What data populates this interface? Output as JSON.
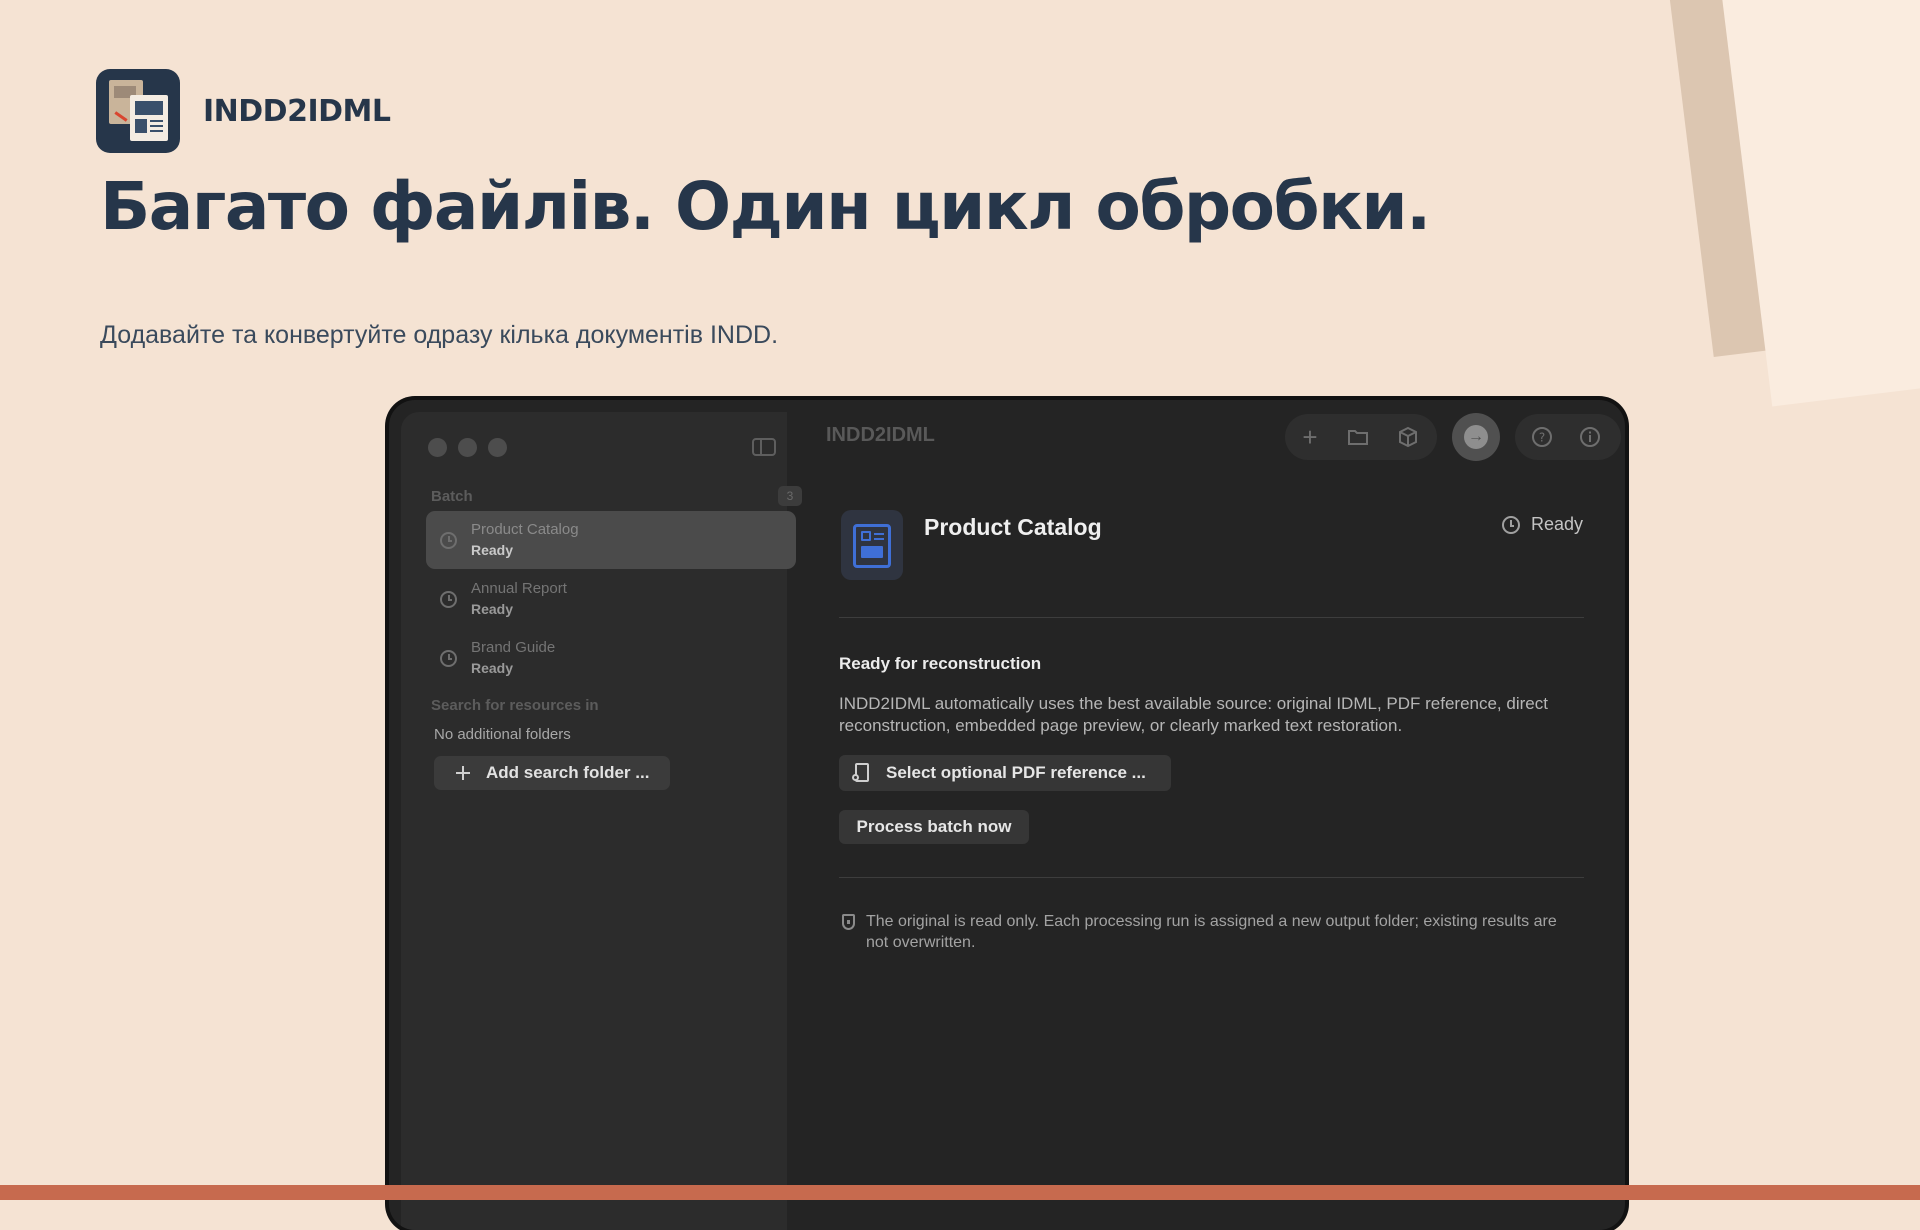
{
  "brand": {
    "name": "INDD2IDML"
  },
  "hero": {
    "headline": "Багато файлів. Один цикл обробки.",
    "subline": "Додавайте та конвертуйте одразу кілька документів INDD."
  },
  "app": {
    "window_title": "INDD2IDML",
    "sidebar": {
      "batch_label": "Batch",
      "batch_count": "3",
      "items": [
        {
          "name": "Product Catalog",
          "status": "Ready",
          "selected": true
        },
        {
          "name": "Annual Report",
          "status": "Ready",
          "selected": false
        },
        {
          "name": "Brand Guide",
          "status": "Ready",
          "selected": false
        }
      ],
      "search_label": "Search for resources in",
      "no_folders": "No additional folders",
      "add_folder_label": "Add search folder ..."
    },
    "toolbar": {
      "icons": [
        "plus-icon",
        "folder-icon",
        "package-icon",
        "run-icon",
        "help-icon",
        "info-icon"
      ]
    },
    "detail": {
      "title": "Product Catalog",
      "status": "Ready",
      "heading": "Ready for reconstruction",
      "description": "INDD2IDML automatically uses the best available source: original IDML, PDF reference, direct reconstruction, embedded page preview, or clearly marked text restoration.",
      "pdf_button": "Select optional PDF reference ...",
      "process_button": "Process batch now",
      "note": "The original is read only. Each processing run is assigned a new output folder; existing results are not overwritten."
    }
  },
  "colors": {
    "background": "#f5e3d3",
    "heading": "#26364a",
    "accent_bar": "#c76a4e",
    "window": "#242424"
  }
}
